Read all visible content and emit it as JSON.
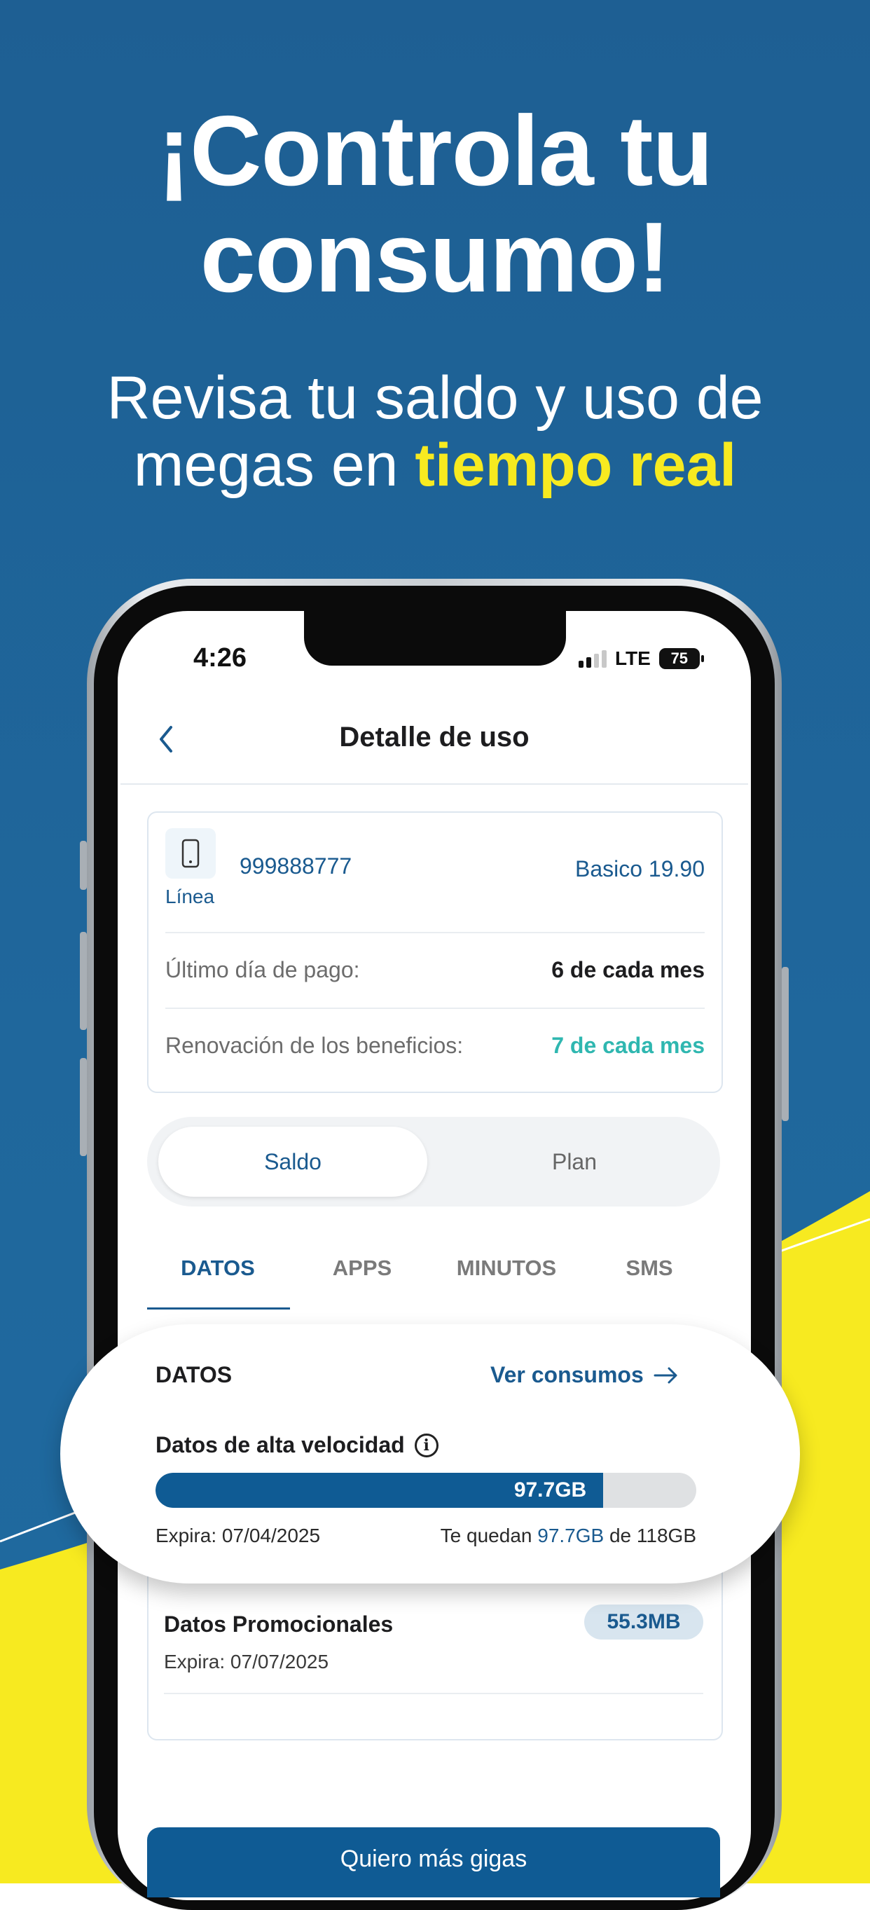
{
  "promo": {
    "headline_line1": "¡Controla tu",
    "headline_line2": "consumo!",
    "sub_line1": "Revisa tu saldo y uso de",
    "sub_line2_prefix": "megas en ",
    "sub_line2_highlight": "tiempo real",
    "accent_color": "#f7ea20",
    "background_color": "#1f659a"
  },
  "status_bar": {
    "time": "4:26",
    "network": "LTE",
    "battery": "75"
  },
  "header": {
    "title": "Detalle de uso"
  },
  "line_card": {
    "icon_label": "Línea",
    "number": "999888777",
    "plan": "Basico 19.90",
    "rows": [
      {
        "label": "Último día de pago:",
        "value": "6 de cada mes"
      },
      {
        "label": "Renovación de los beneficios:",
        "value": "7 de cada mes"
      }
    ]
  },
  "toggle": {
    "active": "Saldo",
    "inactive": "Plan"
  },
  "tabs": [
    "DATOS",
    "APPS",
    "MINUTOS",
    "SMS"
  ],
  "data_section": {
    "title": "DATOS",
    "link": "Ver consumos",
    "high_speed_label": "Datos de alta velocidad",
    "bar_value": "97.7GB",
    "bar_fraction": 0.828,
    "expires": "Expira: 07/04/2025",
    "remaining_prefix": "Te quedan ",
    "remaining_amount": "97.7GB",
    "remaining_suffix": " de 118GB"
  },
  "promo_data": {
    "title": "Datos Promocionales",
    "expires": "Expira: 07/07/2025",
    "amount": "55.3MB"
  },
  "cta": {
    "label": "Quiero más gigas"
  }
}
